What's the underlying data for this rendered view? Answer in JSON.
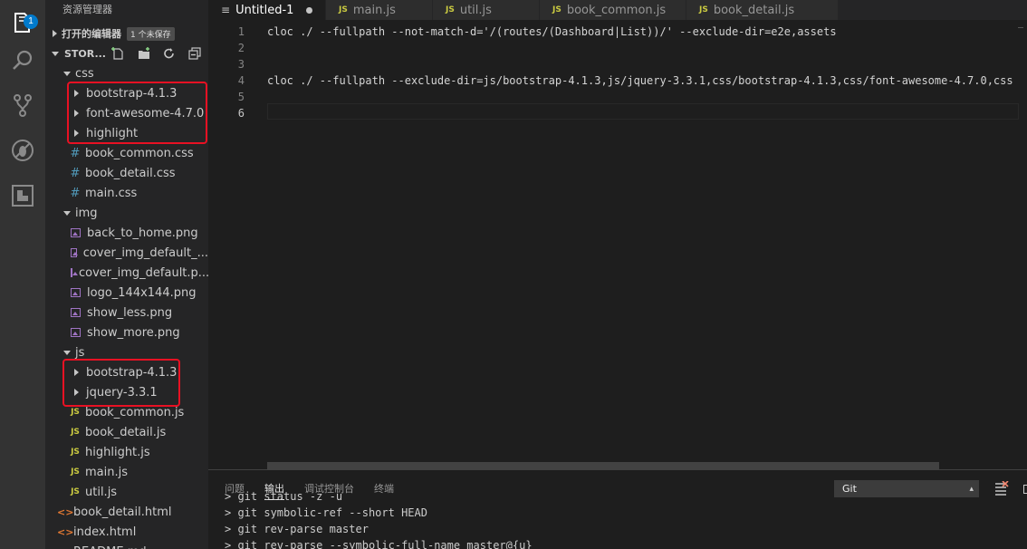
{
  "activity_bar": {
    "items": [
      {
        "name": "explorer",
        "badge": "1"
      },
      {
        "name": "search"
      },
      {
        "name": "source-control"
      },
      {
        "name": "debug"
      },
      {
        "name": "extensions"
      }
    ]
  },
  "sidebar": {
    "title": "资源管理器",
    "open_editors_label": "打开的编辑器",
    "unsaved_badge": "1 个未保存",
    "root_label": "STOR...",
    "tree": [
      {
        "label": "css",
        "type": "folder-open",
        "indent": 1
      },
      {
        "label": "bootstrap-4.1.3",
        "type": "folder-closed",
        "indent": 2
      },
      {
        "label": "font-awesome-4.7.0",
        "type": "folder-closed",
        "indent": 2
      },
      {
        "label": "highlight",
        "type": "folder-closed",
        "indent": 2
      },
      {
        "label": "book_common.css",
        "type": "css",
        "indent": 2
      },
      {
        "label": "book_detail.css",
        "type": "css",
        "indent": 2
      },
      {
        "label": "main.css",
        "type": "css",
        "indent": 2
      },
      {
        "label": "img",
        "type": "folder-open",
        "indent": 1
      },
      {
        "label": "back_to_home.png",
        "type": "img",
        "indent": 2
      },
      {
        "label": "cover_img_default_...",
        "type": "img",
        "indent": 2
      },
      {
        "label": "cover_img_default.p...",
        "type": "img",
        "indent": 2
      },
      {
        "label": "logo_144x144.png",
        "type": "img",
        "indent": 2
      },
      {
        "label": "show_less.png",
        "type": "img",
        "indent": 2
      },
      {
        "label": "show_more.png",
        "type": "img",
        "indent": 2
      },
      {
        "label": "js",
        "type": "folder-open",
        "indent": 1
      },
      {
        "label": "bootstrap-4.1.3",
        "type": "folder-closed",
        "indent": 2
      },
      {
        "label": "jquery-3.3.1",
        "type": "folder-closed",
        "indent": 2
      },
      {
        "label": "book_common.js",
        "type": "js",
        "indent": 2
      },
      {
        "label": "book_detail.js",
        "type": "js",
        "indent": 2
      },
      {
        "label": "highlight.js",
        "type": "js",
        "indent": 2
      },
      {
        "label": "main.js",
        "type": "js",
        "indent": 2
      },
      {
        "label": "util.js",
        "type": "js",
        "indent": 2
      },
      {
        "label": "book_detail.html",
        "type": "html",
        "indent": 1
      },
      {
        "label": "index.html",
        "type": "html",
        "indent": 1
      },
      {
        "label": "README.md",
        "type": "md",
        "indent": 1
      }
    ]
  },
  "tabs": [
    {
      "label": "Untitled-1",
      "icon": "≡",
      "active": true,
      "dirty": true
    },
    {
      "label": "main.js",
      "icon": "JS"
    },
    {
      "label": "util.js",
      "icon": "JS"
    },
    {
      "label": "book_common.js",
      "icon": "JS"
    },
    {
      "label": "book_detail.js",
      "icon": "JS"
    }
  ],
  "editor": {
    "lines": [
      {
        "num": "1",
        "text": "cloc ./ --fullpath --not-match-d='/(routes/(Dashboard|List))/' --exclude-dir=e2e,assets"
      },
      {
        "num": "2",
        "text": ""
      },
      {
        "num": "3",
        "text": ""
      },
      {
        "num": "4",
        "text": "cloc ./ --fullpath  --exclude-dir=js/bootstrap-4.1.3,js/jquery-3.3.1,css/bootstrap-4.1.3,css/font-awesome-4.7.0,css"
      },
      {
        "num": "5",
        "text": ""
      },
      {
        "num": "6",
        "text": ""
      }
    ],
    "current_line": "6"
  },
  "panel": {
    "tabs": [
      "问题",
      "输出",
      "调试控制台",
      "终端"
    ],
    "active_tab": "输出",
    "output_channel": "Git",
    "output_lines": [
      "> git status -z -u",
      "> git symbolic-ref --short HEAD",
      "> git rev-parse master",
      "> git rev-parse --symbolic-full-name master@{u}"
    ]
  },
  "colors": {
    "highlight_box": "#e81123",
    "accent": "#007acc"
  }
}
